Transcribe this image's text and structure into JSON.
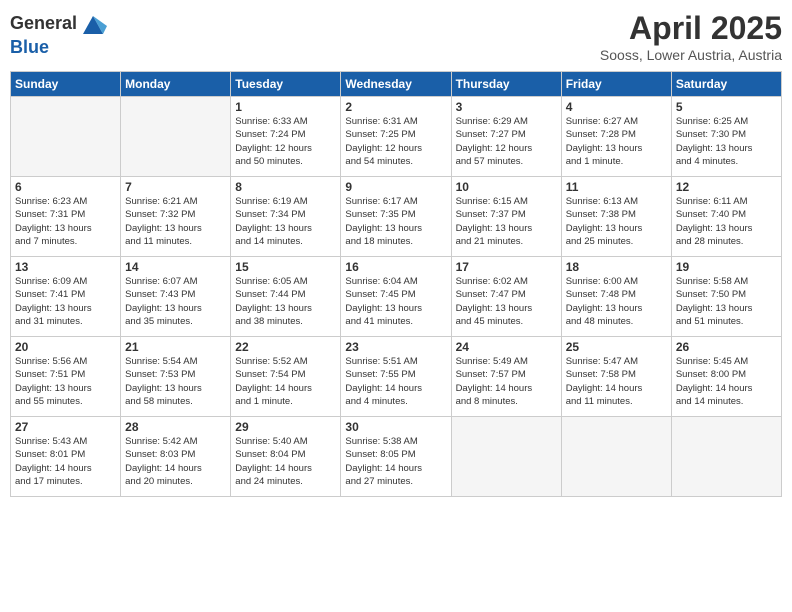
{
  "logo": {
    "line1": "General",
    "line2": "Blue"
  },
  "title": "April 2025",
  "subtitle": "Sooss, Lower Austria, Austria",
  "days_header": [
    "Sunday",
    "Monday",
    "Tuesday",
    "Wednesday",
    "Thursday",
    "Friday",
    "Saturday"
  ],
  "weeks": [
    [
      {
        "day": "",
        "info": ""
      },
      {
        "day": "",
        "info": ""
      },
      {
        "day": "1",
        "info": "Sunrise: 6:33 AM\nSunset: 7:24 PM\nDaylight: 12 hours\nand 50 minutes."
      },
      {
        "day": "2",
        "info": "Sunrise: 6:31 AM\nSunset: 7:25 PM\nDaylight: 12 hours\nand 54 minutes."
      },
      {
        "day": "3",
        "info": "Sunrise: 6:29 AM\nSunset: 7:27 PM\nDaylight: 12 hours\nand 57 minutes."
      },
      {
        "day": "4",
        "info": "Sunrise: 6:27 AM\nSunset: 7:28 PM\nDaylight: 13 hours\nand 1 minute."
      },
      {
        "day": "5",
        "info": "Sunrise: 6:25 AM\nSunset: 7:30 PM\nDaylight: 13 hours\nand 4 minutes."
      }
    ],
    [
      {
        "day": "6",
        "info": "Sunrise: 6:23 AM\nSunset: 7:31 PM\nDaylight: 13 hours\nand 7 minutes."
      },
      {
        "day": "7",
        "info": "Sunrise: 6:21 AM\nSunset: 7:32 PM\nDaylight: 13 hours\nand 11 minutes."
      },
      {
        "day": "8",
        "info": "Sunrise: 6:19 AM\nSunset: 7:34 PM\nDaylight: 13 hours\nand 14 minutes."
      },
      {
        "day": "9",
        "info": "Sunrise: 6:17 AM\nSunset: 7:35 PM\nDaylight: 13 hours\nand 18 minutes."
      },
      {
        "day": "10",
        "info": "Sunrise: 6:15 AM\nSunset: 7:37 PM\nDaylight: 13 hours\nand 21 minutes."
      },
      {
        "day": "11",
        "info": "Sunrise: 6:13 AM\nSunset: 7:38 PM\nDaylight: 13 hours\nand 25 minutes."
      },
      {
        "day": "12",
        "info": "Sunrise: 6:11 AM\nSunset: 7:40 PM\nDaylight: 13 hours\nand 28 minutes."
      }
    ],
    [
      {
        "day": "13",
        "info": "Sunrise: 6:09 AM\nSunset: 7:41 PM\nDaylight: 13 hours\nand 31 minutes."
      },
      {
        "day": "14",
        "info": "Sunrise: 6:07 AM\nSunset: 7:43 PM\nDaylight: 13 hours\nand 35 minutes."
      },
      {
        "day": "15",
        "info": "Sunrise: 6:05 AM\nSunset: 7:44 PM\nDaylight: 13 hours\nand 38 minutes."
      },
      {
        "day": "16",
        "info": "Sunrise: 6:04 AM\nSunset: 7:45 PM\nDaylight: 13 hours\nand 41 minutes."
      },
      {
        "day": "17",
        "info": "Sunrise: 6:02 AM\nSunset: 7:47 PM\nDaylight: 13 hours\nand 45 minutes."
      },
      {
        "day": "18",
        "info": "Sunrise: 6:00 AM\nSunset: 7:48 PM\nDaylight: 13 hours\nand 48 minutes."
      },
      {
        "day": "19",
        "info": "Sunrise: 5:58 AM\nSunset: 7:50 PM\nDaylight: 13 hours\nand 51 minutes."
      }
    ],
    [
      {
        "day": "20",
        "info": "Sunrise: 5:56 AM\nSunset: 7:51 PM\nDaylight: 13 hours\nand 55 minutes."
      },
      {
        "day": "21",
        "info": "Sunrise: 5:54 AM\nSunset: 7:53 PM\nDaylight: 13 hours\nand 58 minutes."
      },
      {
        "day": "22",
        "info": "Sunrise: 5:52 AM\nSunset: 7:54 PM\nDaylight: 14 hours\nand 1 minute."
      },
      {
        "day": "23",
        "info": "Sunrise: 5:51 AM\nSunset: 7:55 PM\nDaylight: 14 hours\nand 4 minutes."
      },
      {
        "day": "24",
        "info": "Sunrise: 5:49 AM\nSunset: 7:57 PM\nDaylight: 14 hours\nand 8 minutes."
      },
      {
        "day": "25",
        "info": "Sunrise: 5:47 AM\nSunset: 7:58 PM\nDaylight: 14 hours\nand 11 minutes."
      },
      {
        "day": "26",
        "info": "Sunrise: 5:45 AM\nSunset: 8:00 PM\nDaylight: 14 hours\nand 14 minutes."
      }
    ],
    [
      {
        "day": "27",
        "info": "Sunrise: 5:43 AM\nSunset: 8:01 PM\nDaylight: 14 hours\nand 17 minutes."
      },
      {
        "day": "28",
        "info": "Sunrise: 5:42 AM\nSunset: 8:03 PM\nDaylight: 14 hours\nand 20 minutes."
      },
      {
        "day": "29",
        "info": "Sunrise: 5:40 AM\nSunset: 8:04 PM\nDaylight: 14 hours\nand 24 minutes."
      },
      {
        "day": "30",
        "info": "Sunrise: 5:38 AM\nSunset: 8:05 PM\nDaylight: 14 hours\nand 27 minutes."
      },
      {
        "day": "",
        "info": ""
      },
      {
        "day": "",
        "info": ""
      },
      {
        "day": "",
        "info": ""
      }
    ]
  ]
}
